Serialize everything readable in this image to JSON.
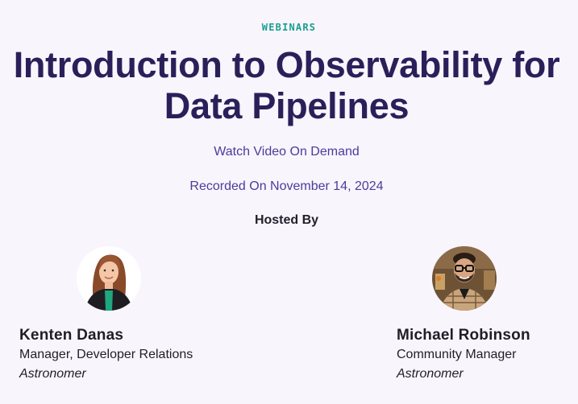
{
  "header": {
    "eyebrow": "WEBINARS",
    "title": "Introduction to Observability for Data Pipelines",
    "watch_text": "Watch Video On Demand",
    "recorded_text": "Recorded On November 14, 2024",
    "hosted_by": "Hosted By"
  },
  "hosts": [
    {
      "name": "Kenten Danas",
      "role": "Manager, Developer Relations",
      "company": "Astronomer"
    },
    {
      "name": "Michael Robinson",
      "role": "Community Manager",
      "company": "Astronomer"
    }
  ],
  "colors": {
    "background": "#f8f5fd",
    "eyebrow": "#1a9e8f",
    "title": "#2a2059",
    "accent_text": "#4b3c9b"
  }
}
